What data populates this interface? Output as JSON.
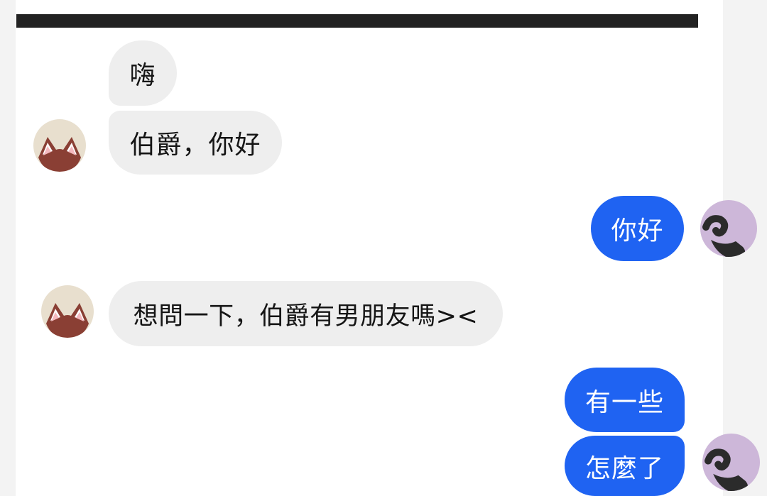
{
  "theme": {
    "incoming_bubble": "#eeeeee",
    "outgoing_bubble": "#1f63f2",
    "top_bar": "#222222"
  },
  "messages": [
    {
      "sender": "other",
      "text": "嗨"
    },
    {
      "sender": "other",
      "text": "伯爵，你好",
      "avatar": "cat-avatar"
    },
    {
      "sender": "me",
      "text": "你好",
      "avatar": "swirl-avatar"
    },
    {
      "sender": "other",
      "text": "想問一下，伯爵有男朋友嗎><",
      "avatar": "cat-avatar"
    },
    {
      "sender": "me",
      "text": "有一些"
    },
    {
      "sender": "me",
      "text": "怎麼了",
      "avatar": "swirl-avatar"
    }
  ]
}
